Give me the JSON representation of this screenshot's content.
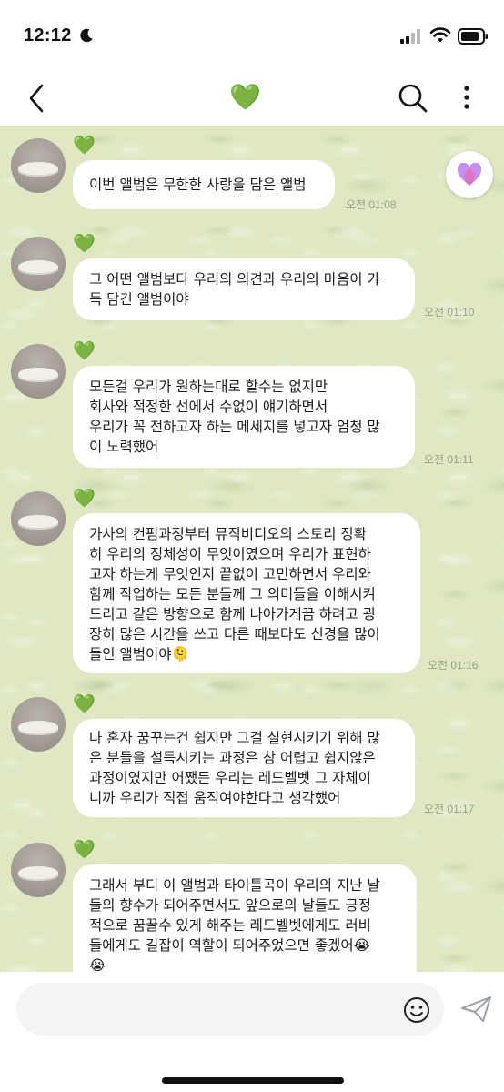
{
  "status": {
    "time": "12:12"
  },
  "nav": {
    "title_icon": "green-heart-icon",
    "title": "💚"
  },
  "sender": {
    "heart": "💚"
  },
  "messages": [
    {
      "lines": [
        "이번 앨범은 무한한 사랑을 담은 앨범"
      ],
      "time": "오전 01:08"
    },
    {
      "lines": [
        "그 어떤 앨범보다 우리의 의견과 우리의 마음이 가",
        "득 담긴 앨범이야"
      ],
      "time": "오전 01:10"
    },
    {
      "lines": [
        "모든걸 우리가 원하는대로 할수는 없지만",
        "회사와 적정한 선에서 수없이 얘기하면서",
        "우리가 꼭 전하고자 하는 메세지를 넣고자 엄청 많",
        "이 노력했어"
      ],
      "time": "오전 01:11"
    },
    {
      "lines": [
        "가사의 컨펌과정부터 뮤직비디오의 스토리  정확",
        "히 우리의 정체성이 무엇이였으며 우리가 표현하",
        "고자 하는게 무엇인지 끝없이 고민하면서 우리와",
        "함께 작업하는 모든 분들께 그 의미들을 이해시켜",
        "드리고 같은 방향으로 함께 나아가게끔 하려고 굉",
        "장히 많은 시간을 쓰고 다른 때보다도 신경을 많이",
        "들인 앨범이야🫠"
      ],
      "time": "오전 01:16"
    },
    {
      "lines": [
        "나 혼자 꿈꾸는건 쉽지만 그걸 실현시키기 위해 많",
        "은 분들을 설득시키는 과정은 참 어렵고 쉽지않은",
        "과정이였지만 어쨌든 우리는 레드벨벳 그 자체이",
        "니까 우리가 직접 움직여야한다고 생각했어"
      ],
      "time": "오전 01:17"
    },
    {
      "lines": [
        "그래서 부디 이 앨범과 타이틀곡이 우리의 지난 날",
        "들의 향수가 되어주면서도 앞으로의 날들도 긍정",
        "적으로 꿈꿀수 있게 해주는 레드벨벳에게도 러비",
        "들에게도 길잡이 역할이 되어주었으면 좋겠어😭",
        "😭"
      ],
      "time": ""
    }
  ],
  "input": {
    "placeholder": ""
  },
  "icons": [
    "moon-icon",
    "signal-icon",
    "wifi-icon",
    "battery-icon",
    "back-icon",
    "search-icon",
    "more-icon",
    "reaction-heart-icon",
    "emoji-icon",
    "send-icon"
  ],
  "colors": {
    "chat_background": "#dfe8c3",
    "bubble": "#ffffff",
    "heart_green": "#2ecc40"
  }
}
